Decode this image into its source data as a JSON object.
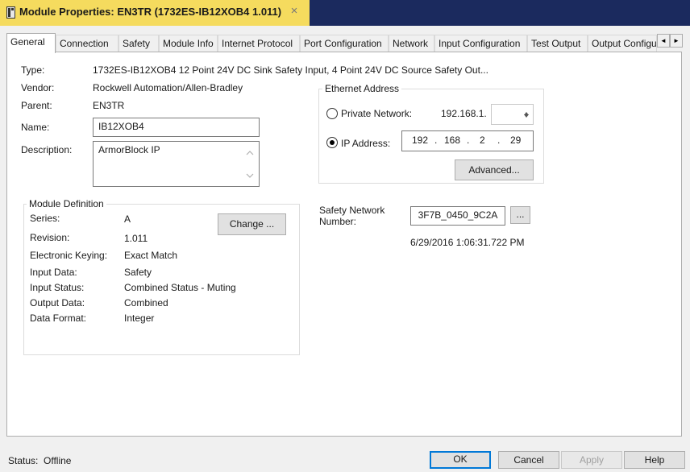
{
  "window": {
    "title": "Module Properties: EN3TR (1732ES-IB12XOB4 1.011)",
    "close_glyph": "×"
  },
  "tabs": [
    {
      "label": "General",
      "active": true
    },
    {
      "label": "Connection"
    },
    {
      "label": "Safety"
    },
    {
      "label": "Module Info"
    },
    {
      "label": "Internet Protocol"
    },
    {
      "label": "Port Configuration"
    },
    {
      "label": "Network"
    },
    {
      "label": "Input Configuration"
    },
    {
      "label": "Test Output"
    },
    {
      "label": "Output Configu"
    }
  ],
  "tab_scroll": {
    "left": "◄",
    "right": "►"
  },
  "general": {
    "type_label": "Type:",
    "type_value": "1732ES-IB12XOB4 12 Point 24V DC Sink Safety Input, 4 Point 24V DC Source Safety Out...",
    "vendor_label": "Vendor:",
    "vendor_value": "Rockwell Automation/Allen-Bradley",
    "parent_label": "Parent:",
    "parent_value": "EN3TR",
    "name_label": "Name:",
    "name_value": "IB12XOB4",
    "description_label": "Description:",
    "description_value": "ArmorBlock IP"
  },
  "module_definition": {
    "title": "Module Definition",
    "change_button": "Change ...",
    "rows": [
      {
        "label": "Series:",
        "value": "A"
      },
      {
        "label": "Revision:",
        "value": "1.011"
      },
      {
        "label": "Electronic Keying:",
        "value": "Exact Match"
      },
      {
        "label": "Input Data:",
        "value": "Safety"
      },
      {
        "label": "Input Status:",
        "value": "Combined Status - Muting"
      },
      {
        "label": "Output Data:",
        "value": "Combined"
      },
      {
        "label": "Data Format:",
        "value": "Integer"
      }
    ]
  },
  "ethernet": {
    "title": "Ethernet Address",
    "private_network_label": "Private Network:",
    "private_network_prefix": "192.168.1.",
    "private_network_value": "",
    "ip_address_label": "IP Address:",
    "ip_address_selected": true,
    "ip_octets": [
      "192",
      "168",
      "2",
      "29"
    ],
    "ip_separator": ".",
    "advanced_button": "Advanced..."
  },
  "safety_network": {
    "label": "Safety Network Number:",
    "value": "3F7B_0450_9C2A",
    "browse_button": "...",
    "timestamp": "6/29/2016 1:06:31.722 PM"
  },
  "status": {
    "label": "Status:",
    "value": "Offline"
  },
  "buttons": {
    "ok": "OK",
    "cancel": "Cancel",
    "apply": "Apply",
    "help": "Help"
  },
  "colors": {
    "title_tab": "#f5db5e",
    "title_bar_rest": "#1b2a5e",
    "focus_blue": "#0078d7"
  }
}
